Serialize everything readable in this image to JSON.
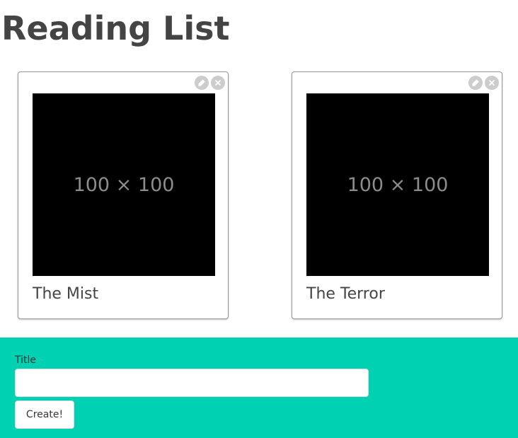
{
  "header": {
    "title": "Reading List"
  },
  "books": [
    {
      "title": "The Mist",
      "cover_text": "100 × 100",
      "actions": {
        "edit_icon": "pencil-icon",
        "delete_icon": "close-icon"
      }
    },
    {
      "title": "The Terror",
      "cover_text": "100 × 100",
      "actions": {
        "edit_icon": "pencil-icon",
        "delete_icon": "close-icon"
      }
    }
  ],
  "form": {
    "title_label": "Title",
    "title_value": "",
    "title_placeholder": "",
    "create_label": "Create!"
  },
  "colors": {
    "form_background": "#00d1b2",
    "heading_text": "#444444",
    "action_button": "#cccccc"
  }
}
